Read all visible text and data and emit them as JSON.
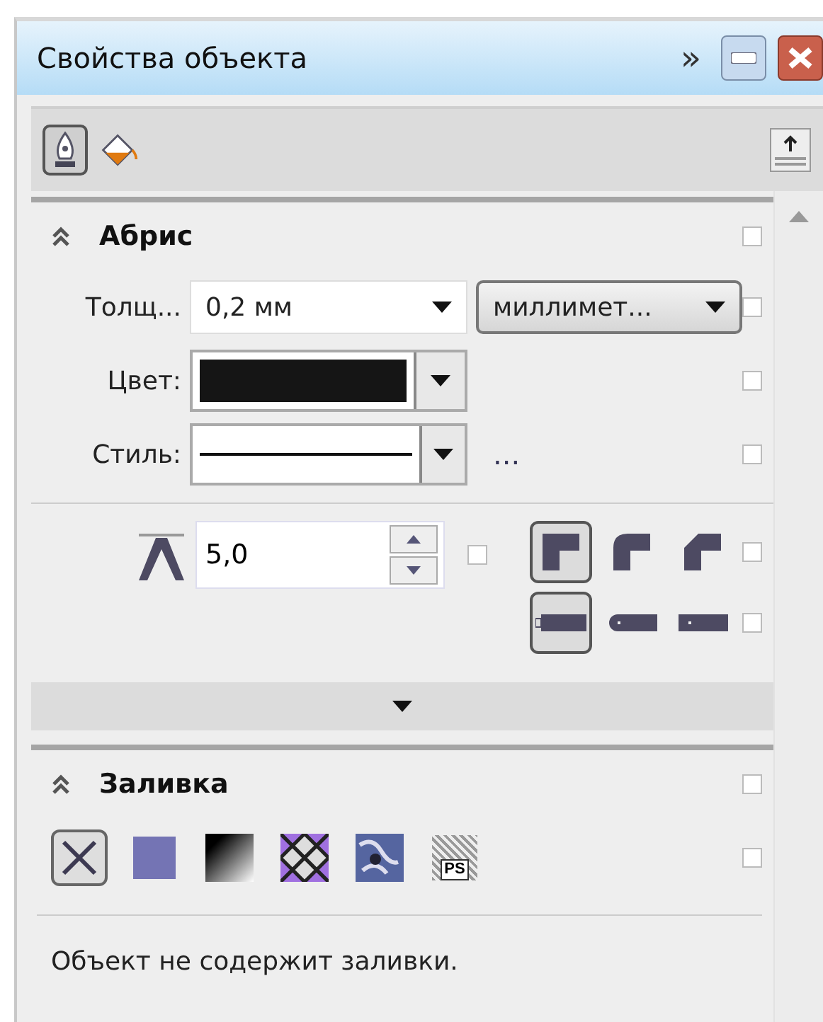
{
  "window": {
    "title": "Свойства объекта",
    "overflow_glyph": "»"
  },
  "toolbar_tabs": [
    {
      "kind": "pen",
      "selected": true
    },
    {
      "kind": "fill",
      "selected": false
    }
  ],
  "outline": {
    "title": "Абрис",
    "expanded": true,
    "lock": {
      "checked": false
    },
    "width": {
      "label": "Толщ...",
      "value": "0,2 мм",
      "lock": {
        "checked": false
      }
    },
    "units": {
      "value": "миллимет..."
    },
    "color": {
      "label": "Цвет:",
      "color": "#151515",
      "lock": {
        "checked": false
      }
    },
    "style": {
      "label": "Стиль:",
      "more": "...",
      "lock": {
        "checked": false
      }
    },
    "miter": {
      "value": "5,0",
      "lock": {
        "checked": false
      }
    },
    "joins": [
      {
        "kind": "miter",
        "selected": true
      },
      {
        "kind": "round",
        "selected": false
      },
      {
        "kind": "bevel",
        "selected": false
      }
    ],
    "joins_lock": {
      "checked": false
    },
    "caps": [
      {
        "kind": "butt",
        "selected": true
      },
      {
        "kind": "round",
        "selected": false
      },
      {
        "kind": "square",
        "selected": false
      }
    ],
    "caps_lock": {
      "checked": false
    }
  },
  "fill": {
    "title": "Заливка",
    "expanded": true,
    "lock": {
      "checked": false
    },
    "types": [
      {
        "kind": "none",
        "selected": true
      },
      {
        "kind": "uniform",
        "selected": false
      },
      {
        "kind": "fountain",
        "selected": false
      },
      {
        "kind": "pattern",
        "selected": false
      },
      {
        "kind": "texture",
        "selected": false
      },
      {
        "kind": "postscript",
        "label": "PS",
        "selected": false
      }
    ],
    "types_lock": {
      "checked": false
    },
    "message": "Объект не содержит заливки."
  }
}
